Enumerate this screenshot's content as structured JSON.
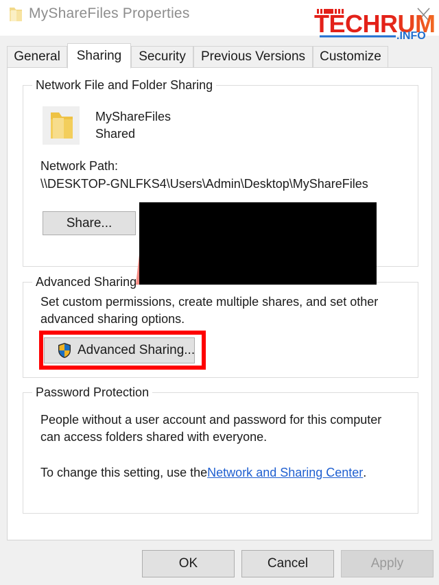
{
  "window": {
    "title": "MyShareFiles Properties",
    "folder_icon": "folder-icon",
    "close_icon": "close-icon"
  },
  "watermark": {
    "brand": "TECHRUM",
    "suffix": ".INFO",
    "brand_color": "#e32119",
    "suffix_color": "#1f6fd0"
  },
  "tabs": [
    {
      "label": "General",
      "active": false
    },
    {
      "label": "Sharing",
      "active": true
    },
    {
      "label": "Security",
      "active": false
    },
    {
      "label": "Previous Versions",
      "active": false
    },
    {
      "label": "Customize",
      "active": false
    }
  ],
  "network_sharing": {
    "group_title": "Network File and Folder Sharing",
    "folder_name": "MyShareFiles",
    "folder_status": "Shared",
    "network_path_label": "Network Path:",
    "network_path_value": "\\\\DESKTOP-GNLFKS4\\Users\\Admin\\Desktop\\MyShareFiles",
    "share_button": "Share..."
  },
  "advanced_sharing": {
    "group_title": "Advanced Sharing",
    "description_line1": "Set custom permissions, create multiple shares, and set other",
    "description_line2": "advanced sharing options.",
    "button_label": "Advanced Sharing...",
    "button_icon": "uac-shield-icon",
    "highlight_color": "#fe0000"
  },
  "password_protection": {
    "group_title": "Password Protection",
    "description_line1": "People without a user account and password for this computer",
    "description_line2": "can access folders shared with everyone.",
    "setting_prefix": "To change this setting, use the ",
    "setting_link": "Network and Sharing Center",
    "setting_suffix": "."
  },
  "footer": {
    "ok_label": "OK",
    "cancel_label": "Cancel",
    "apply_label": "Apply",
    "apply_disabled": true
  },
  "annotations": {
    "redaction_color": "#000000",
    "arrow_color": "#f58b84"
  }
}
